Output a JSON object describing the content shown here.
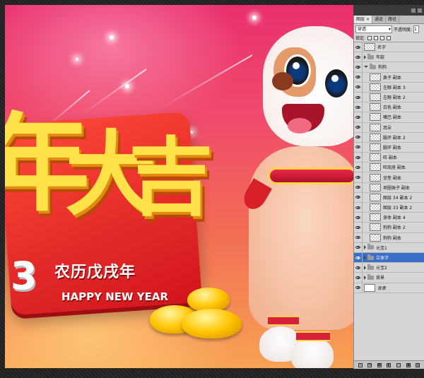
{
  "artwork": {
    "big_chars": [
      "年",
      "大",
      "吉"
    ],
    "year_fragment": "3",
    "banner_cn": "农历戊戌年",
    "banner_en": "HAPPY NEW YEAR"
  },
  "panel": {
    "tabs": [
      {
        "label": "图层",
        "close": "×"
      },
      {
        "label": "通道"
      },
      {
        "label": "路径"
      }
    ],
    "blend_mode": "穿透",
    "opacity_label": "不透明度:",
    "opacity_value": "1",
    "lock_label": "锁定:",
    "layers": [
      {
        "name": "名字",
        "type": "layer",
        "thumb": "checker",
        "indent": 0
      },
      {
        "name": "年款",
        "type": "group",
        "open": false,
        "indent": 0
      },
      {
        "name": "狗狗",
        "type": "group",
        "open": true,
        "indent": 0
      },
      {
        "name": "鼻子 副本",
        "type": "layer",
        "thumb": "checker",
        "indent": 1
      },
      {
        "name": "左眼 副本 3",
        "type": "layer",
        "thumb": "checker",
        "indent": 1
      },
      {
        "name": "左眼 副本 2",
        "type": "layer",
        "thumb": "checker",
        "indent": 1
      },
      {
        "name": "白色 副本",
        "type": "layer",
        "thumb": "checker",
        "indent": 1
      },
      {
        "name": "嘴巴 副本",
        "type": "layer",
        "thumb": "checker",
        "indent": 1
      },
      {
        "name": "耳朵",
        "type": "layer",
        "thumb": "checker",
        "indent": 1
      },
      {
        "name": "腿环 副本 2",
        "type": "layer",
        "thumb": "checker",
        "indent": 1
      },
      {
        "name": "腿环 副本",
        "type": "layer",
        "thumb": "checker",
        "indent": 1
      },
      {
        "name": "旺 副本",
        "type": "layer",
        "thumb": "checker",
        "indent": 1
      },
      {
        "name": "旺底座 副本",
        "type": "layer",
        "thumb": "checker",
        "indent": 1
      },
      {
        "name": "坐垫 副本",
        "type": "layer",
        "thumb": "checker",
        "indent": 1
      },
      {
        "name": "项圈珠子 副本",
        "type": "layer",
        "thumb": "checker",
        "indent": 1
      },
      {
        "name": "图层 34 副本 2",
        "type": "layer",
        "thumb": "checker",
        "indent": 1
      },
      {
        "name": "图层 33 副本 2",
        "type": "layer",
        "thumb": "checker",
        "indent": 1
      },
      {
        "name": "身体 副本 4",
        "type": "layer",
        "thumb": "checker",
        "indent": 1
      },
      {
        "name": "狗狗 副本 2",
        "type": "layer",
        "thumb": "checker",
        "indent": 1
      },
      {
        "name": "狗狗 副本",
        "type": "layer",
        "thumb": "checker",
        "indent": 1
      },
      {
        "name": "元宝1",
        "type": "group",
        "open": false,
        "indent": 0
      },
      {
        "name": "立体字",
        "type": "group",
        "open": false,
        "indent": 0,
        "selected": true
      },
      {
        "name": "元宝2",
        "type": "group",
        "open": false,
        "indent": 0
      },
      {
        "name": "背景",
        "type": "group",
        "open": false,
        "indent": 0
      },
      {
        "name": "背景",
        "type": "layer",
        "thumb": "white",
        "indent": 0,
        "italic": true
      }
    ],
    "bottom_icons": [
      "link-icon",
      "fx-icon",
      "mask-icon",
      "adjustment-icon",
      "folder-icon",
      "new-layer-icon",
      "trash-icon"
    ],
    "bottom_glyphs": [
      "∞",
      "fx",
      "◘",
      "◐",
      "▭",
      "▣",
      "▥"
    ]
  },
  "colors": {
    "selection": "#3b6ec8",
    "panel_bg": "#d6d6d6"
  }
}
